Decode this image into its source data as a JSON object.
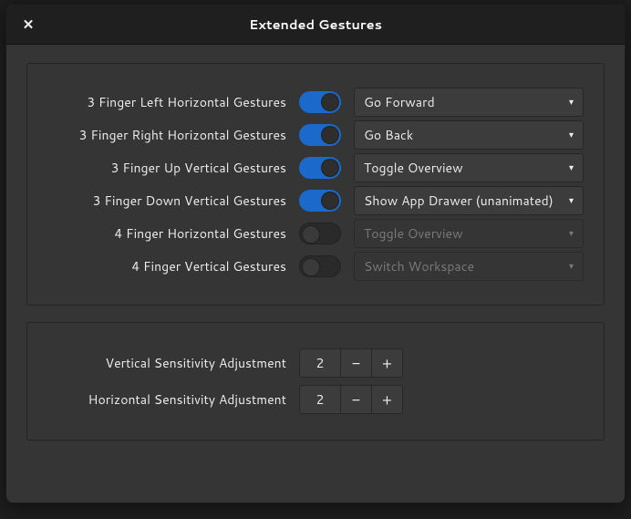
{
  "title": "Extended Gestures",
  "gestures": [
    {
      "label": "3 Finger Left Horizontal Gestures",
      "enabled": true,
      "action": "Go Forward"
    },
    {
      "label": "3 Finger Right Horizontal Gestures",
      "enabled": true,
      "action": "Go Back"
    },
    {
      "label": "3 Finger Up Vertical Gestures",
      "enabled": true,
      "action": "Toggle Overview"
    },
    {
      "label": "3 Finger Down Vertical Gestures",
      "enabled": true,
      "action": "Show App Drawer (unanimated)"
    },
    {
      "label": "4 Finger Horizontal Gestures",
      "enabled": false,
      "action": "Toggle Overview"
    },
    {
      "label": "4 Finger Vertical Gestures",
      "enabled": false,
      "action": "Switch Workspace"
    }
  ],
  "sensitivity": {
    "vertical": {
      "label": "Vertical Sensitivity Adjustment",
      "value": "2"
    },
    "horizontal": {
      "label": "Horizontal Sensitivity Adjustment",
      "value": "2"
    }
  },
  "icons": {
    "minus": "−",
    "plus": "+",
    "caret": "▾",
    "close": "✕"
  }
}
